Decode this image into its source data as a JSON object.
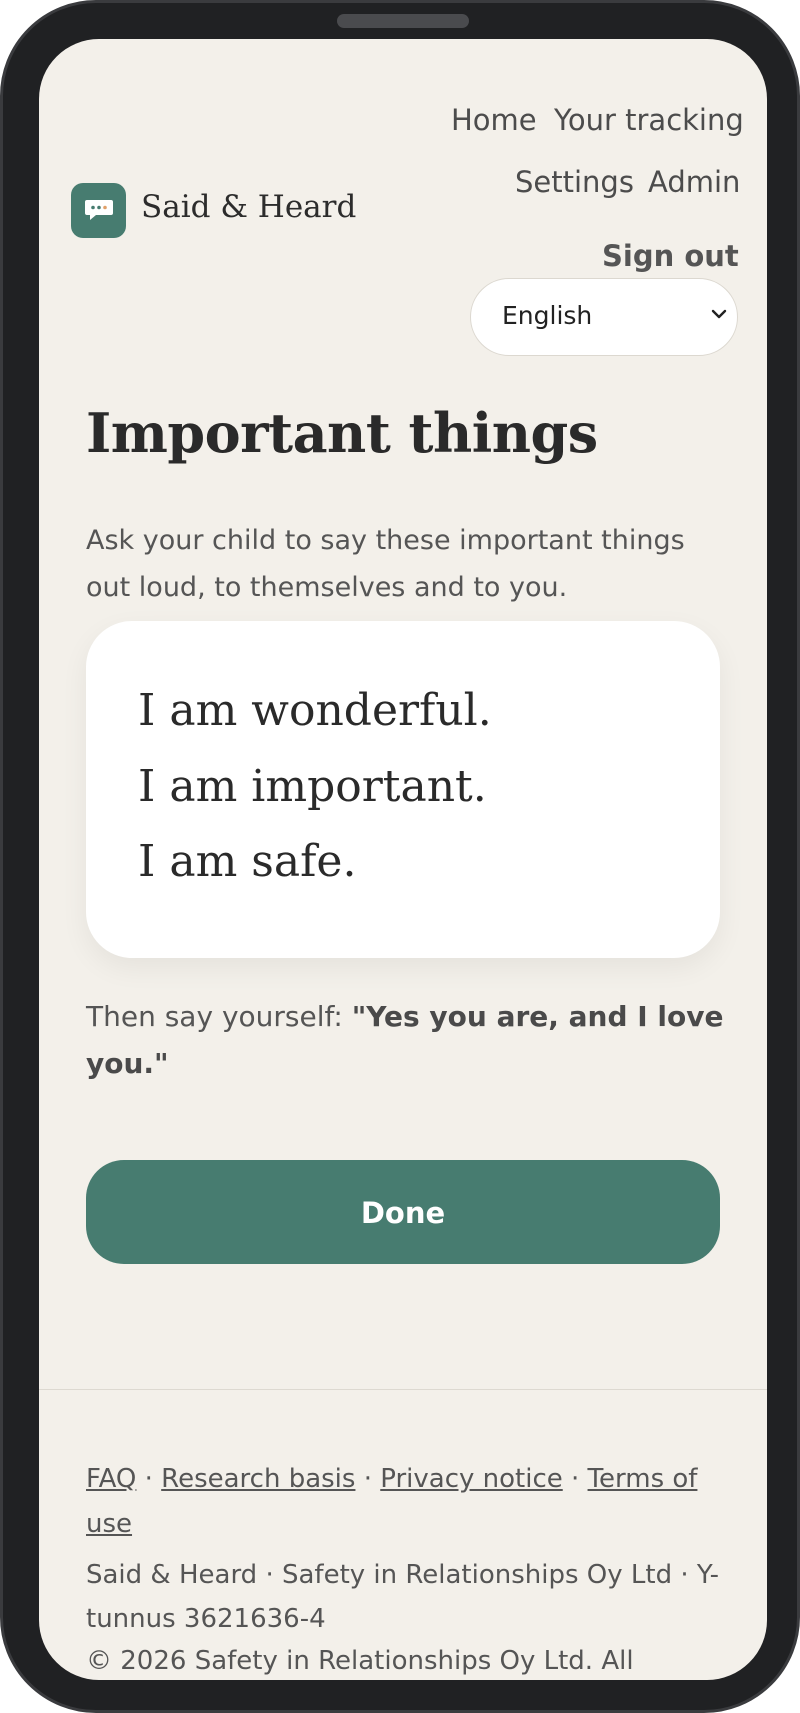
{
  "nav": {
    "home": "Home",
    "tracking": "Your tracking",
    "settings": "Settings",
    "admin": "Admin",
    "sign_out": "Sign out"
  },
  "brand": {
    "name": "Said & Heard",
    "logo_icon": "speech-bubble-icon",
    "color": "#477c70"
  },
  "language": {
    "selected": "English",
    "icon": "chevron-down-icon"
  },
  "main": {
    "title": "Important things",
    "intro": "Ask your child to say these important things out loud, to themselves and to you.",
    "affirmations": [
      "I am wonderful.",
      "I am important.",
      "I am safe."
    ],
    "then_prefix": "Then say yourself:",
    "then_quote": "\"Yes you are, and I love you.\"",
    "done_label": "Done"
  },
  "footer": {
    "links": [
      "FAQ",
      "Research basis",
      "Privacy notice",
      "Terms of use"
    ],
    "separator": "·",
    "info": "Said & Heard · Safety in Relationships Oy Ltd · Y-tunnus 3621636-4",
    "copyright": "© 2026 Safety in Relationships Oy Ltd. All"
  }
}
